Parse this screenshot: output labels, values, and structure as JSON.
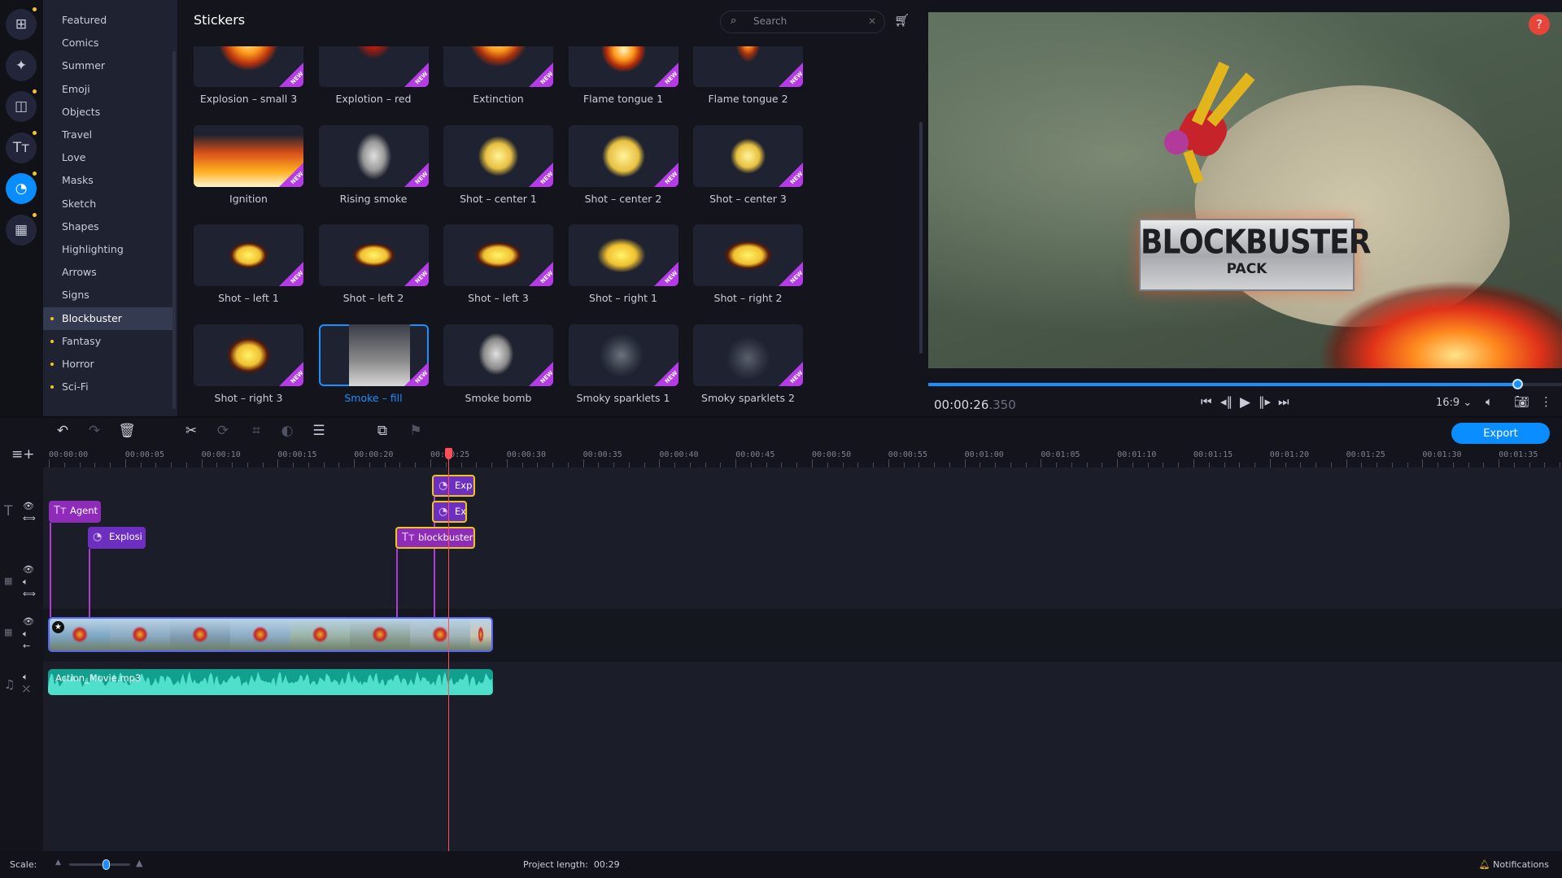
{
  "rail": {
    "items": [
      {
        "icon": "import-folder-icon",
        "glyph": "⊞",
        "dot": true,
        "active": false
      },
      {
        "icon": "magic-wand-icon",
        "glyph": "✦",
        "dot": false,
        "active": false
      },
      {
        "icon": "transitions-icon",
        "glyph": "◫",
        "dot": true,
        "active": false
      },
      {
        "icon": "titles-icon",
        "glyph": "Tт",
        "dot": true,
        "active": false
      },
      {
        "icon": "stickers-icon",
        "glyph": "◔",
        "dot": true,
        "active": true
      },
      {
        "icon": "more-tools-icon",
        "glyph": "▦",
        "dot": true,
        "active": false
      }
    ]
  },
  "categories": [
    {
      "label": "Featured",
      "dot": false
    },
    {
      "label": "Comics",
      "dot": false
    },
    {
      "label": "Summer",
      "dot": false
    },
    {
      "label": "Emoji",
      "dot": false
    },
    {
      "label": "Objects",
      "dot": false
    },
    {
      "label": "Travel",
      "dot": false
    },
    {
      "label": "Love",
      "dot": false
    },
    {
      "label": "Masks",
      "dot": false
    },
    {
      "label": "Sketch",
      "dot": false
    },
    {
      "label": "Shapes",
      "dot": false
    },
    {
      "label": "Highlighting",
      "dot": false
    },
    {
      "label": "Arrows",
      "dot": false
    },
    {
      "label": "Signs",
      "dot": false
    },
    {
      "label": "Blockbuster",
      "dot": true,
      "selected": true
    },
    {
      "label": "Fantasy",
      "dot": true
    },
    {
      "label": "Horror",
      "dot": true
    },
    {
      "label": "Sci-Fi",
      "dot": true
    }
  ],
  "stickers_panel": {
    "title": "Stickers",
    "search_placeholder": "Search",
    "new_badge_label": "NEW",
    "items": [
      {
        "label": "Explosion – small 3",
        "new": true
      },
      {
        "label": "Explotion – red",
        "new": true
      },
      {
        "label": "Extinction",
        "new": true
      },
      {
        "label": "Flame tongue 1",
        "new": true
      },
      {
        "label": "Flame tongue 2",
        "new": true
      },
      {
        "label": "Ignition",
        "new": true
      },
      {
        "label": "Rising smoke",
        "new": true
      },
      {
        "label": "Shot – center 1",
        "new": true
      },
      {
        "label": "Shot – center 2",
        "new": true
      },
      {
        "label": "Shot – center 3",
        "new": true
      },
      {
        "label": "Shot – left 1",
        "new": true
      },
      {
        "label": "Shot – left 2",
        "new": true
      },
      {
        "label": "Shot – left 3",
        "new": true
      },
      {
        "label": "Shot – right 1",
        "new": true
      },
      {
        "label": "Shot – right 2",
        "new": true
      },
      {
        "label": "Shot – right 3",
        "new": true
      },
      {
        "label": "Smoke – fill",
        "new": true,
        "selected": true
      },
      {
        "label": "Smoke bomb",
        "new": true
      },
      {
        "label": "Smoky sparklets 1",
        "new": true
      },
      {
        "label": "Smoky sparklets 2",
        "new": true
      }
    ]
  },
  "preview": {
    "title_main": "BLOCKBUSTER",
    "title_sub": "PACK",
    "help_label": "?",
    "progress": 0.93,
    "time_main": "00:00:26",
    "time_ms": ".350",
    "aspect": "16:9"
  },
  "toolbar": {
    "export_label": "Export"
  },
  "ruler": {
    "labels": [
      "00:00:00",
      "00:00:05",
      "00:00:10",
      "00:00:15",
      "00:00:20",
      "00:00:25",
      "00:00:30",
      "00:00:35",
      "00:00:40",
      "00:00:45",
      "00:00:50",
      "00:00:55",
      "00:01:00",
      "00:01:05",
      "00:01:10",
      "00:01:15",
      "00:01:20",
      "00:01:25",
      "00:01:30",
      "00:01:35"
    ]
  },
  "timeline": {
    "clips": [
      {
        "label": "Agent",
        "type": "text"
      },
      {
        "label": "Explosi",
        "type": "sticker"
      },
      {
        "label": "blockbuster",
        "type": "text",
        "selected": true
      },
      {
        "label": "Exp",
        "type": "sticker",
        "selected": true
      },
      {
        "label": "Ex",
        "type": "sticker",
        "selected": true
      }
    ],
    "audio_label": "Action_Movie.mp3",
    "playhead_time": "00:00:26.350"
  },
  "status": {
    "scale_label": "Scale:",
    "scale_value": 0.6,
    "project_length_label": "Project length:",
    "project_length": "00:29",
    "notifications_label": "Notifications"
  },
  "colors": {
    "accent": "#0a8dff",
    "text_clip": "#8e2bb8",
    "sticker_clip": "#6c2fc0",
    "audio": "#12a08e",
    "playhead": "#ff4d5a",
    "selected_border": "#f0c419"
  }
}
